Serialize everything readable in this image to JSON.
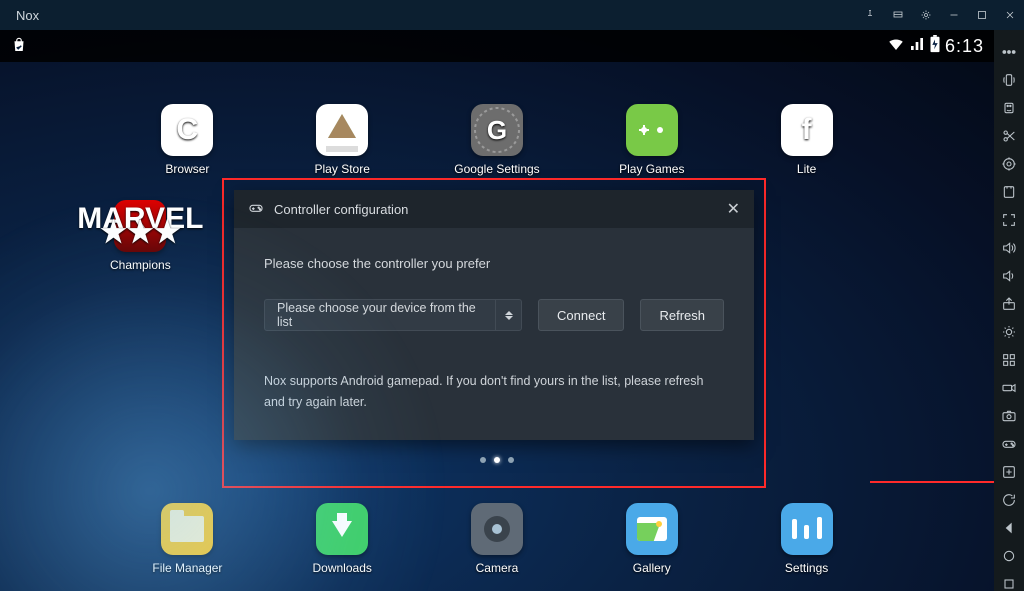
{
  "titlebar": {
    "app_name": "Nox"
  },
  "statusbar": {
    "clock": "6:13"
  },
  "apps_top": [
    {
      "id": "browser",
      "label": "Browser"
    },
    {
      "id": "playstore",
      "label": "Play Store"
    },
    {
      "id": "gsettings",
      "label": "Google Settings"
    },
    {
      "id": "playgames",
      "label": "Play Games"
    },
    {
      "id": "lite",
      "label": "Lite"
    }
  ],
  "apps_row2": [
    {
      "id": "champions",
      "label": "Champions"
    }
  ],
  "apps_bottom": [
    {
      "id": "files",
      "label": "File Manager"
    },
    {
      "id": "dl",
      "label": "Downloads"
    },
    {
      "id": "cam",
      "label": "Camera"
    },
    {
      "id": "gallery",
      "label": "Gallery"
    },
    {
      "id": "settings",
      "label": "Settings"
    }
  ],
  "dialog": {
    "title": "Controller configuration",
    "intro": "Please choose the controller you prefer",
    "select_placeholder": "Please choose your device from the list",
    "connect_label": "Connect",
    "refresh_label": "Refresh",
    "hint": "Nox supports Android gamepad. If you don't find yours in the list, please refresh and try again later."
  },
  "sidebar_icons": [
    "more",
    "shake",
    "keymap",
    "scissors",
    "location",
    "apk",
    "fullscreen",
    "volume-up",
    "volume-down",
    "share",
    "brightness",
    "macro",
    "record",
    "screenshot",
    "controller",
    "multi",
    "rotate",
    "back",
    "home",
    "recent"
  ]
}
